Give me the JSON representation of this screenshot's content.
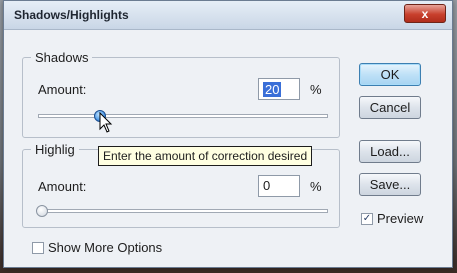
{
  "window": {
    "title": "Shadows/Highlights",
    "close_glyph": "x"
  },
  "shadows": {
    "group_label": "Shadows",
    "amount_label": "Amount:",
    "amount_value": "20",
    "amount_unit": "%",
    "slider_percent": 20
  },
  "highlights": {
    "group_label": "Highlig",
    "amount_label": "Amount:",
    "amount_value": "0",
    "amount_unit": "%",
    "slider_percent": 0
  },
  "tooltip": {
    "text": "Enter the amount of correction desired"
  },
  "buttons": {
    "ok": "OK",
    "cancel": "Cancel",
    "load": "Load...",
    "save": "Save..."
  },
  "options": {
    "preview_label": "Preview",
    "preview_checked": true,
    "show_more_label": "Show More Options",
    "show_more_checked": false
  },
  "colors": {
    "accent": "#3a6fd8",
    "close_button": "#c8402d",
    "tooltip_bg": "#ffffe1"
  },
  "icons": {
    "close": "close-icon",
    "cursor": "pointer-cursor-icon",
    "slider_thumb": "slider-thumb-icon"
  }
}
